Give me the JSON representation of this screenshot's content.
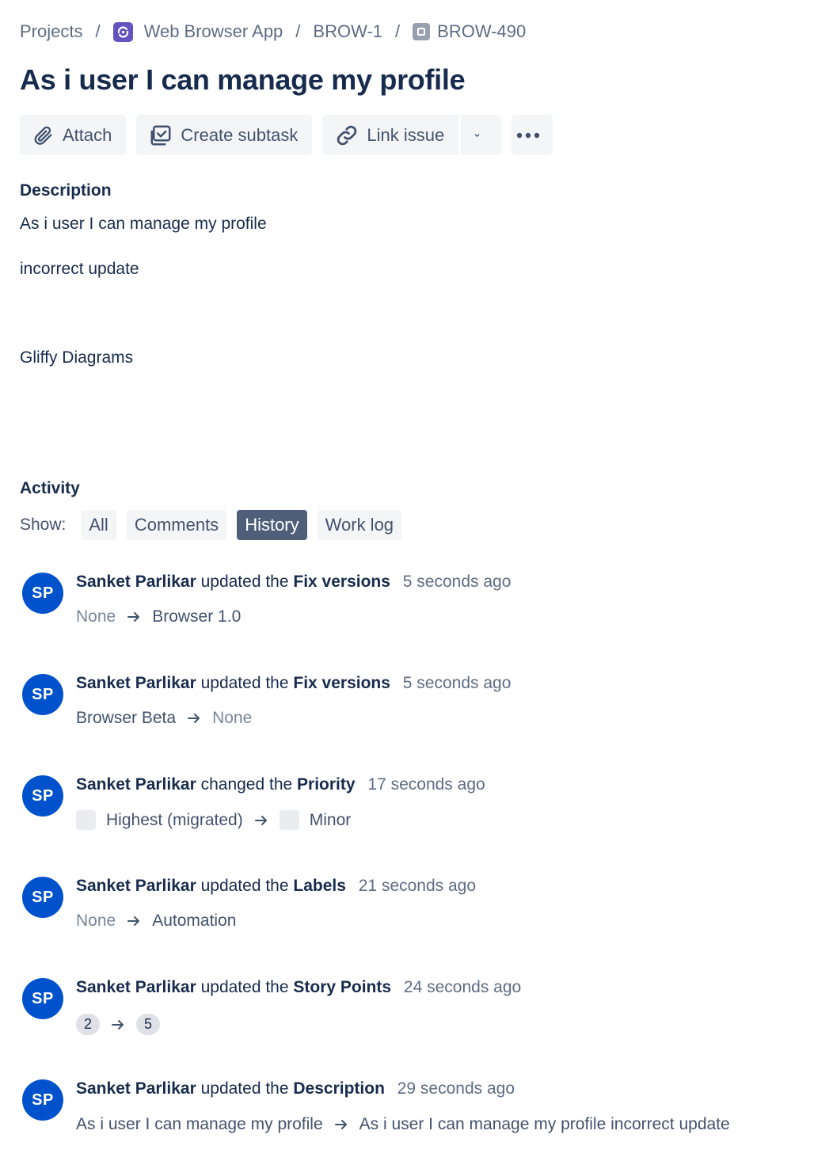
{
  "breadcrumb": {
    "projects": "Projects",
    "project_name": "Web Browser App",
    "parent": "BROW-1",
    "issue_key": "BROW-490",
    "separator": "/"
  },
  "issue": {
    "title": "As i user I can manage my profile"
  },
  "toolbar": {
    "attach": "Attach",
    "create_subtask": "Create subtask",
    "link_issue": "Link issue"
  },
  "description": {
    "heading": "Description",
    "line1": "As i user I can manage my profile",
    "line2": "incorrect update",
    "line3": "Gliffy Diagrams"
  },
  "activity": {
    "heading": "Activity",
    "show_label": "Show:",
    "filters": [
      "All",
      "Comments",
      "History",
      "Work log"
    ],
    "active_filter": "History",
    "entries": [
      {
        "initials": "SP",
        "user": "Sanket Parlikar",
        "action": "updated the",
        "field": "Fix versions",
        "time": "5 seconds ago",
        "from": "None",
        "to": "Browser 1.0"
      },
      {
        "initials": "SP",
        "user": "Sanket Parlikar",
        "action": "updated the",
        "field": "Fix versions",
        "time": "5 seconds ago",
        "from": "Browser Beta",
        "to": "None"
      },
      {
        "initials": "SP",
        "user": "Sanket Parlikar",
        "action": "changed the",
        "field": "Priority",
        "time": "17 seconds ago",
        "from": "Highest (migrated)",
        "to": "Minor"
      },
      {
        "initials": "SP",
        "user": "Sanket Parlikar",
        "action": "updated the",
        "field": "Labels",
        "time": "21 seconds ago",
        "from": "None",
        "to": "Automation"
      },
      {
        "initials": "SP",
        "user": "Sanket Parlikar",
        "action": "updated the",
        "field": "Story Points",
        "time": "24 seconds ago",
        "from": "2",
        "to": "5"
      },
      {
        "initials": "SP",
        "user": "Sanket Parlikar",
        "action": "updated the",
        "field": "Description",
        "time": "29 seconds ago",
        "from": "As i user I can manage my profile",
        "to": "As i user I can manage my profile incorrect update"
      }
    ]
  },
  "colors": {
    "avatar": "#0052cc",
    "active_filter_bg": "#505f79",
    "project_icon": "#6554c0",
    "title": "#172b4d"
  }
}
